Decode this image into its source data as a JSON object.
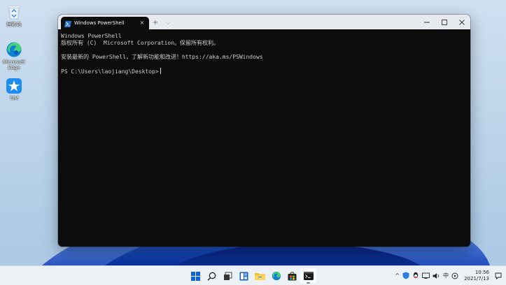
{
  "desktop": {
    "icons": [
      {
        "label": "回收站"
      },
      {
        "label": "Microsoft Edge"
      },
      {
        "label": "TIM"
      }
    ]
  },
  "window": {
    "tab_title": "Windows PowerShell",
    "tab_close": "×",
    "new_tab": "+",
    "dropdown": "⌵"
  },
  "terminal": {
    "lines": [
      "Windows PowerShell",
      "版权所有 (C)  Microsoft Corporation。保留所有权利。",
      "",
      "安装最新的 PowerShell，了解新功能和改进！https://aka.ms/PSWindows",
      "",
      "PS C:\\Users\\laojiang\\Desktop>"
    ]
  },
  "tray": {
    "chevron": "^",
    "ime": "中",
    "time": "10:56",
    "date": "2021/7/13"
  },
  "colors": {
    "terminal_bg": "#0c0c0c",
    "terminal_fg": "#cccccc",
    "titlebar": "#e7ebef",
    "taskbar": "#eef2f7",
    "accent": "#0a63d8"
  }
}
